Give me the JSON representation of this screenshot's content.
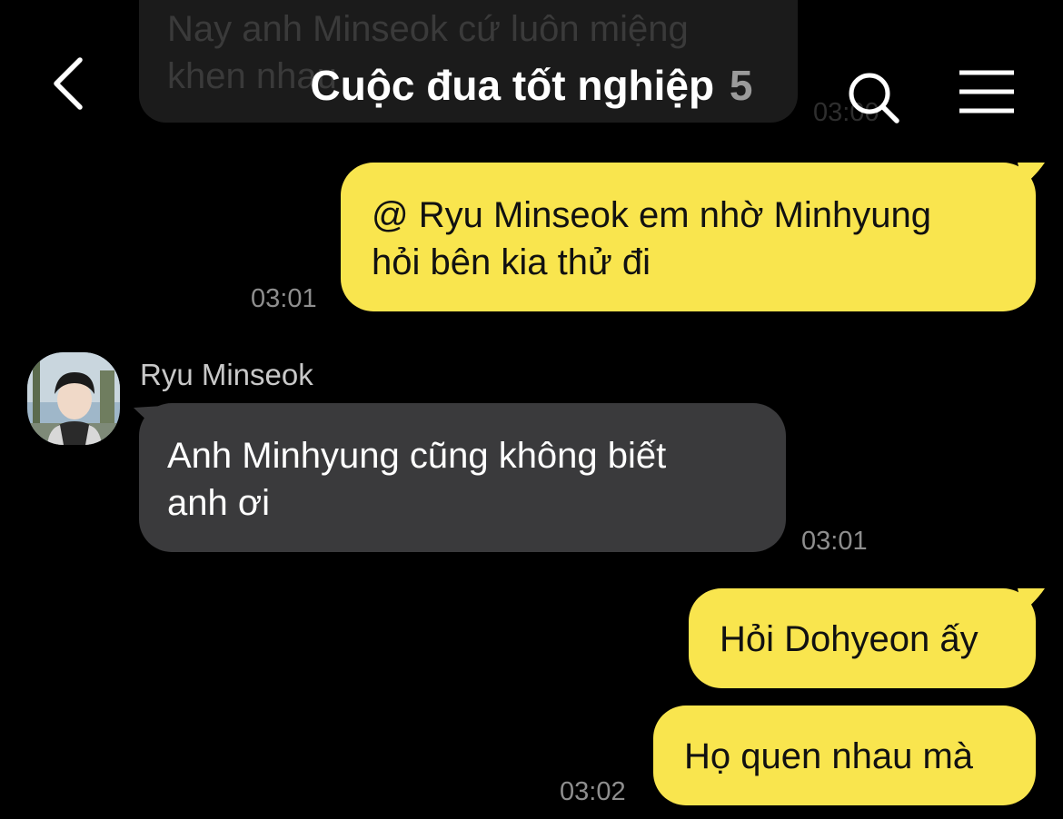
{
  "header": {
    "title": "Cuộc đua tốt nghiệp",
    "member_count": "5"
  },
  "ghost_message": {
    "text": "Nay anh Minseok cứ luôn miệng\nkhen nhau",
    "time": "03:00"
  },
  "messages": [
    {
      "from": "me",
      "text": "@ Ryu Minseok em nhờ Minhyung\nhỏi bên kia thử đi",
      "time": "03:01"
    },
    {
      "from": "Ryu Minseok",
      "sender_name": "Ryu Minseok",
      "text": "Anh Minhyung cũng không biết\nanh ơi",
      "time": "03:01"
    },
    {
      "from": "me",
      "text": "Hỏi Dohyeon ấy"
    },
    {
      "from": "me",
      "text": "Họ quen nhau mà",
      "time": "03:02"
    }
  ],
  "colors": {
    "background": "#000000",
    "my_bubble": "#f9e54e",
    "their_bubble": "#3a3a3c",
    "timestamp": "#8e8e8e"
  },
  "icons": [
    "back-arrow-icon",
    "search-icon",
    "menu-icon"
  ]
}
